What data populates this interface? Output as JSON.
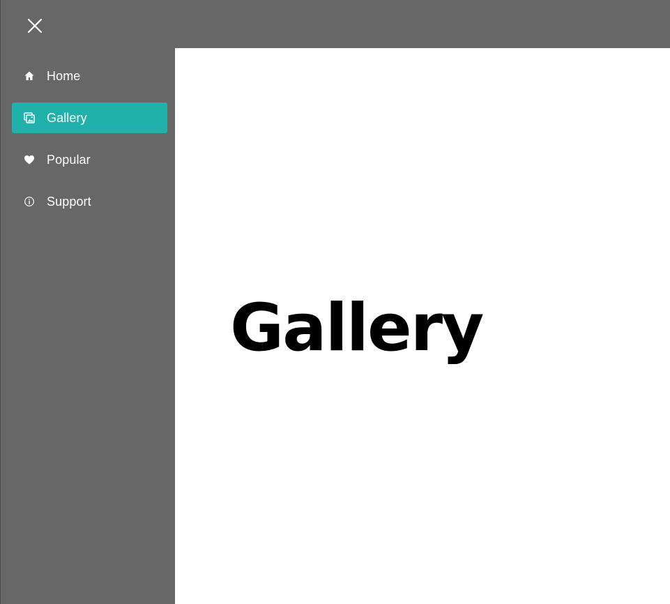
{
  "close_button": {
    "icon": "close-icon",
    "color": "#ffffff"
  },
  "nav": {
    "active_color": "#20b2aa",
    "items": [
      {
        "label": "Home",
        "icon": "home-icon",
        "active": false
      },
      {
        "label": "Gallery",
        "icon": "images-icon",
        "active": true
      },
      {
        "label": "Popular",
        "icon": "heart-icon",
        "active": false
      },
      {
        "label": "Support",
        "icon": "info-icon",
        "active": false
      }
    ]
  },
  "main": {
    "title": "Gallery"
  },
  "colors": {
    "sidebar_bg": "#676767",
    "content_bg": "#ffffff",
    "text_light": "#ffffff",
    "text_dark": "#000000"
  }
}
